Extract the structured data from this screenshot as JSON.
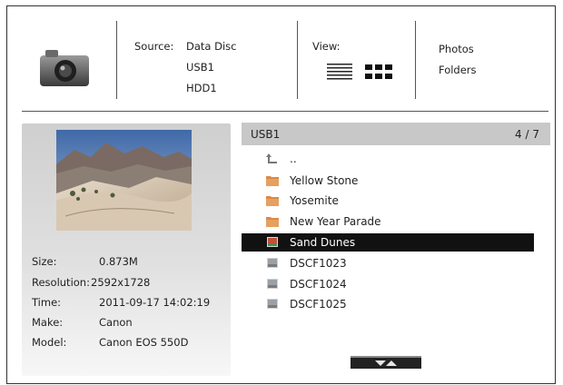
{
  "header": {
    "source_label": "Source:",
    "sources": [
      "Data Disc",
      "USB1",
      "HDD1"
    ],
    "view_label": "View:",
    "modes": [
      "Photos",
      "Folders"
    ]
  },
  "info": {
    "rows": [
      {
        "key": "Size:",
        "value": "0.873M"
      },
      {
        "key": "Resolution:",
        "value": "2592x1728"
      },
      {
        "key": "Time:",
        "value": "2011-09-17 14:02:19"
      },
      {
        "key": "Make:",
        "value": "Canon"
      },
      {
        "key": "Model:",
        "value": "Canon EOS 550D"
      }
    ]
  },
  "list": {
    "location": "USB1",
    "count": "4 / 7",
    "items": [
      {
        "label": "..",
        "icon": "up-arrow-icon"
      },
      {
        "label": "Yellow Stone",
        "icon": "folder-icon"
      },
      {
        "label": "Yosemite",
        "icon": "folder-icon"
      },
      {
        "label": "New Year Parade",
        "icon": "folder-icon"
      },
      {
        "label": "Sand Dunes",
        "icon": "photo-icon",
        "selected": true
      },
      {
        "label": "DSCF1023",
        "icon": "photo-icon"
      },
      {
        "label": "DSCF1024",
        "icon": "photo-icon"
      },
      {
        "label": "DSCF1025",
        "icon": "photo-icon"
      }
    ]
  },
  "colors": {
    "selection": "#111111",
    "header_bar": "#c8c8c8",
    "folder": "#d98a4a"
  }
}
